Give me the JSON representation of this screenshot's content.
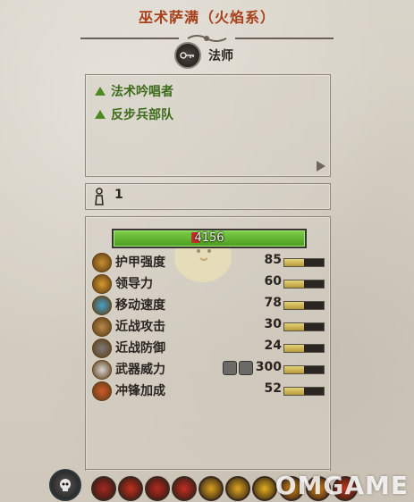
{
  "header": {
    "title": "巫术萨满（火焰系）"
  },
  "unit_class": {
    "label": "法师",
    "icon": "key-icon"
  },
  "traits": [
    {
      "label": "法术吟唱者",
      "icon": "triangle-up-icon"
    },
    {
      "label": "反步兵部队",
      "icon": "triangle-up-icon"
    }
  ],
  "unit_count": {
    "value": "1",
    "icon": "person-icon"
  },
  "health": {
    "value": "4156",
    "color": "#5fb534"
  },
  "stats": [
    {
      "name": "护甲强度",
      "value": "85",
      "icon": "armor-icon",
      "fill": 0.5,
      "color": "#c8902e"
    },
    {
      "name": "领导力",
      "value": "60",
      "icon": "leadership-icon",
      "fill": 0.5,
      "color": "#d79a2e"
    },
    {
      "name": "移动速度",
      "value": "78",
      "icon": "speed-icon",
      "fill": 0.5,
      "color": "#49a2c8"
    },
    {
      "name": "近战攻击",
      "value": "30",
      "icon": "melee-attack-icon",
      "fill": 0.5,
      "color": "#b8894a"
    },
    {
      "name": "近战防御",
      "value": "24",
      "icon": "melee-defense-icon",
      "fill": 0.5,
      "color": "#7d7a76"
    },
    {
      "name": "武器威力",
      "value": "300",
      "icon": "weapon-strength-icon",
      "fill": 0.5,
      "color": "#d8d6d2",
      "modifiers": [
        "ap-icon",
        "magic-icon"
      ]
    },
    {
      "name": "冲锋加成",
      "value": "52",
      "icon": "charge-icon",
      "fill": 0.5,
      "color": "#d05a2a"
    }
  ],
  "skills": {
    "main_icon": "skull-icon",
    "items": [
      {
        "icon": "skill-1-icon",
        "color": "#a32822"
      },
      {
        "icon": "skill-2-icon",
        "color": "#c0301e"
      },
      {
        "icon": "skill-3-icon",
        "color": "#b52a22"
      },
      {
        "icon": "skill-4-icon",
        "color": "#c22e22"
      },
      {
        "icon": "skill-5-icon",
        "color": "#d9a020"
      },
      {
        "icon": "skill-6-icon",
        "color": "#e0a820"
      },
      {
        "icon": "skill-7-icon",
        "color": "#e3b020"
      },
      {
        "icon": "skill-8-icon",
        "color": "#d88a1e"
      },
      {
        "icon": "skill-9-icon",
        "color": "#e28a20"
      },
      {
        "icon": "skill-10-icon",
        "color": "#cc3a1c"
      }
    ]
  },
  "watermark": "OMGAME"
}
